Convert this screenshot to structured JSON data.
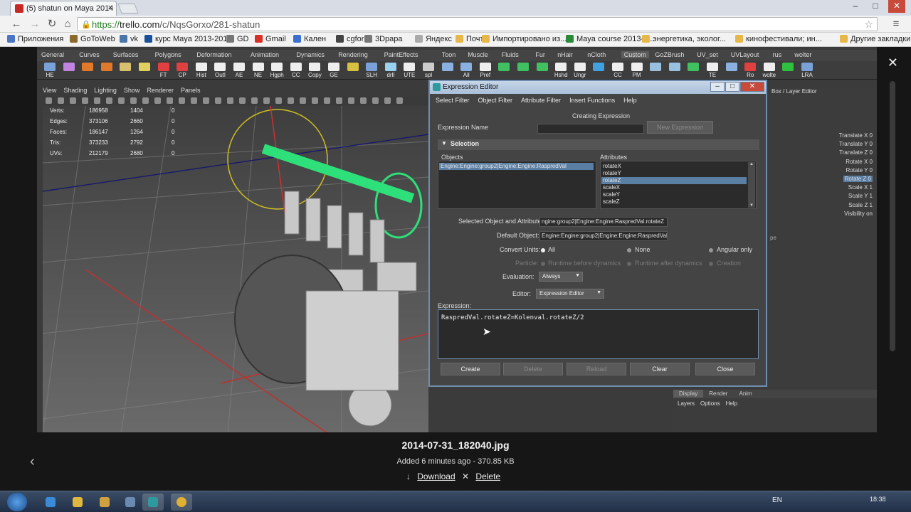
{
  "browser": {
    "tab_title": "(5) shatun on Maya 2014 (",
    "tab_close": "×",
    "win_minimize": "–",
    "win_maximize": "□",
    "win_close": "✕",
    "url_prefix": "https://",
    "url_host": "trello.com",
    "url_path": "/c/NqsGorxo/281-shatun",
    "bookmarks": [
      {
        "label": "Приложения",
        "color": "#4a76c6"
      },
      {
        "label": "GoToWeb",
        "color": "#8a6a2a"
      },
      {
        "label": "vk",
        "color": "#4a76a8"
      },
      {
        "label": "курс Maya 2013-201...",
        "color": "#1a4f9a"
      },
      {
        "label": "GD",
        "color": "#777777"
      },
      {
        "label": "Gmail",
        "color": "#d93025"
      },
      {
        "label": "Кален",
        "color": "#3b6ed1"
      },
      {
        "label": "cgfor",
        "color": "#444444"
      },
      {
        "label": "3Dpapa",
        "color": "#777777"
      },
      {
        "label": "Яндекс",
        "color": "#aaaaaa"
      },
      {
        "label": "Почта",
        "color": "#e6b84a"
      },
      {
        "label": "Импортировано из...",
        "color": "#e6b84a"
      },
      {
        "label": "Maya course 2013-2...",
        "color": "#2a8a3a"
      },
      {
        "label": "энергетика, эколог...",
        "color": "#e6b84a"
      },
      {
        "label": "кинофестивали; ин...",
        "color": "#e6b84a"
      },
      {
        "label": "Другие закладки",
        "color": "#e6b84a"
      }
    ]
  },
  "maya": {
    "shelf_tabs": [
      "General",
      "Curves",
      "Surfaces",
      "Polygons",
      "Deformation",
      "Animation",
      "Dynamics",
      "Rendering",
      "PaintEffects",
      "Toon",
      "Muscle",
      "Fluids",
      "Fur",
      "nHair",
      "nCloth",
      "Custom",
      "GoZBrush",
      "UV_set",
      "UVLayout",
      "rus",
      "wolter"
    ],
    "active_shelf_tab": "Custom",
    "shelf_tools": [
      {
        "label": "HE",
        "color": "#7aa0d8"
      },
      {
        "label": "",
        "color": "#c084e0"
      },
      {
        "label": "",
        "color": "#e07a2a"
      },
      {
        "label": "",
        "color": "#e07a2a"
      },
      {
        "label": "",
        "color": "#d8c070"
      },
      {
        "label": "",
        "color": "#e0d060"
      },
      {
        "label": "FT",
        "color": "#e04040"
      },
      {
        "label": "CP",
        "color": "#e04040"
      },
      {
        "label": "Hist",
        "color": "#eeeeee"
      },
      {
        "label": "Outl",
        "color": "#eeeeee"
      },
      {
        "label": "AE",
        "color": "#eeeeee"
      },
      {
        "label": "NE",
        "color": "#eeeeee"
      },
      {
        "label": "Hgph",
        "color": "#eeeeee"
      },
      {
        "label": "CC",
        "color": "#eeeeee"
      },
      {
        "label": "Copy",
        "color": "#eeeeee"
      },
      {
        "label": "GE",
        "color": "#eeeeee"
      },
      {
        "label": "",
        "color": "#d8c040"
      },
      {
        "label": "SLH",
        "color": "#7aa0d8"
      },
      {
        "label": "drll",
        "color": "#9ad0f0"
      },
      {
        "label": "UTE",
        "color": "#eeeeee"
      },
      {
        "label": "spl",
        "color": "#cccccc"
      },
      {
        "label": "",
        "color": "#8ab0e0"
      },
      {
        "label": "All",
        "color": "#8ab0e0"
      },
      {
        "label": "Pref",
        "color": "#eeeeee"
      },
      {
        "label": "",
        "color": "#40c060"
      },
      {
        "label": "",
        "color": "#40c060"
      },
      {
        "label": "",
        "color": "#40c060"
      },
      {
        "label": "Hshd",
        "color": "#eeeeee"
      },
      {
        "label": "Ungr",
        "color": "#eeeeee"
      },
      {
        "label": "",
        "color": "#40a0e0"
      },
      {
        "label": "CC",
        "color": "#eeeeee"
      },
      {
        "label": "PM",
        "color": "#eeeeee"
      },
      {
        "label": "",
        "color": "#9ac0e0"
      },
      {
        "label": "",
        "color": "#9ac0e0"
      },
      {
        "label": "",
        "color": "#40c060"
      },
      {
        "label": "TE",
        "color": "#eeeeee"
      },
      {
        "label": "",
        "color": "#8ab0e0"
      },
      {
        "label": "Ro",
        "color": "#e04040"
      },
      {
        "label": "wolte",
        "color": "#eeeeee"
      },
      {
        "label": "",
        "color": "#30c040"
      },
      {
        "label": "LRA",
        "color": "#7aa0d8"
      }
    ],
    "panel_menu": [
      "View",
      "Shading",
      "Lighting",
      "Show",
      "Renderer",
      "Panels"
    ],
    "hud": [
      {
        "key": "Verts:",
        "v1": "186958",
        "v2": "1404",
        "v3": "0"
      },
      {
        "key": "Edges:",
        "v1": "373106",
        "v2": "2660",
        "v3": "0"
      },
      {
        "key": "Faces:",
        "v1": "186147",
        "v2": "1264",
        "v3": "0"
      },
      {
        "key": "Tris:",
        "v1": "373233",
        "v2": "2792",
        "v3": "0"
      },
      {
        "key": "UVs:",
        "v1": "212179",
        "v2": "2680",
        "v3": "0"
      }
    ],
    "right_panel_label": "Box / Layer Editor",
    "channels": [
      "Translate X 0",
      "Translate Y 0",
      "Translate Z 0",
      "Rotate X 0",
      "Rotate Y 0",
      "Rotate Z 0",
      "Scale X 1",
      "Scale Y 1",
      "Scale Z 1",
      "Visibility on"
    ],
    "selected_channel_index": 5,
    "right_extra": "pe",
    "layer_tabs": [
      "Display",
      "Render",
      "Anim"
    ],
    "layer_menu": [
      "Layers",
      "Options",
      "Help"
    ]
  },
  "expr": {
    "title": "Expression Editor",
    "menu": [
      "Select Filter",
      "Object Filter",
      "Attribute Filter",
      "Insert Functions",
      "Help"
    ],
    "creating": "Creating Expression",
    "name_label": "Expression Name",
    "name_value": "",
    "new_expression": "New Expression",
    "selection_header": "Selection",
    "objects_label": "Objects",
    "attributes_label": "Attributes",
    "objects": [
      "Engine:Engine:group2|Engine:Engine:RaspredVal"
    ],
    "attributes": [
      "rotateX",
      "rotateY",
      "rotateZ",
      "scaleX",
      "scaleY",
      "scaleZ"
    ],
    "selected_attribute_index": 2,
    "sel_obj_attr_label": "Selected Object and Attribute:",
    "sel_obj_attr_value": "ngine:group2|Engine:Engine:RaspredVal.rotateZ",
    "default_obj_label": "Default Object:",
    "default_obj_value": "Engine:Engine:group2|Engine:Engine:RaspredVal",
    "convert_label": "Convert Units:",
    "convert_options": [
      "All",
      "None",
      "Angular only"
    ],
    "particle_label": "Particle:",
    "particle_options": [
      "Runtime before dynamics",
      "Runtime after dynamics",
      "Creation"
    ],
    "evaluation_label": "Evaluation:",
    "evaluation_value": "Always",
    "editor_label": "Editor:",
    "editor_value": "Expression Editor",
    "expression_label": "Expression:",
    "expression_text": "RaspredVal.rotateZ=Kolenval.rotateZ/2",
    "buttons": [
      "Create",
      "Delete",
      "Reload",
      "Clear",
      "Close"
    ]
  },
  "caption": {
    "filename": "2014-07-31_182040.jpg",
    "meta": "Added 6 minutes ago - 370.85 KB",
    "download": "Download",
    "delete": "Delete",
    "download_icon": "↓",
    "delete_icon": "✕"
  },
  "taskbar": {
    "lang": "EN",
    "clock": "18:38"
  }
}
